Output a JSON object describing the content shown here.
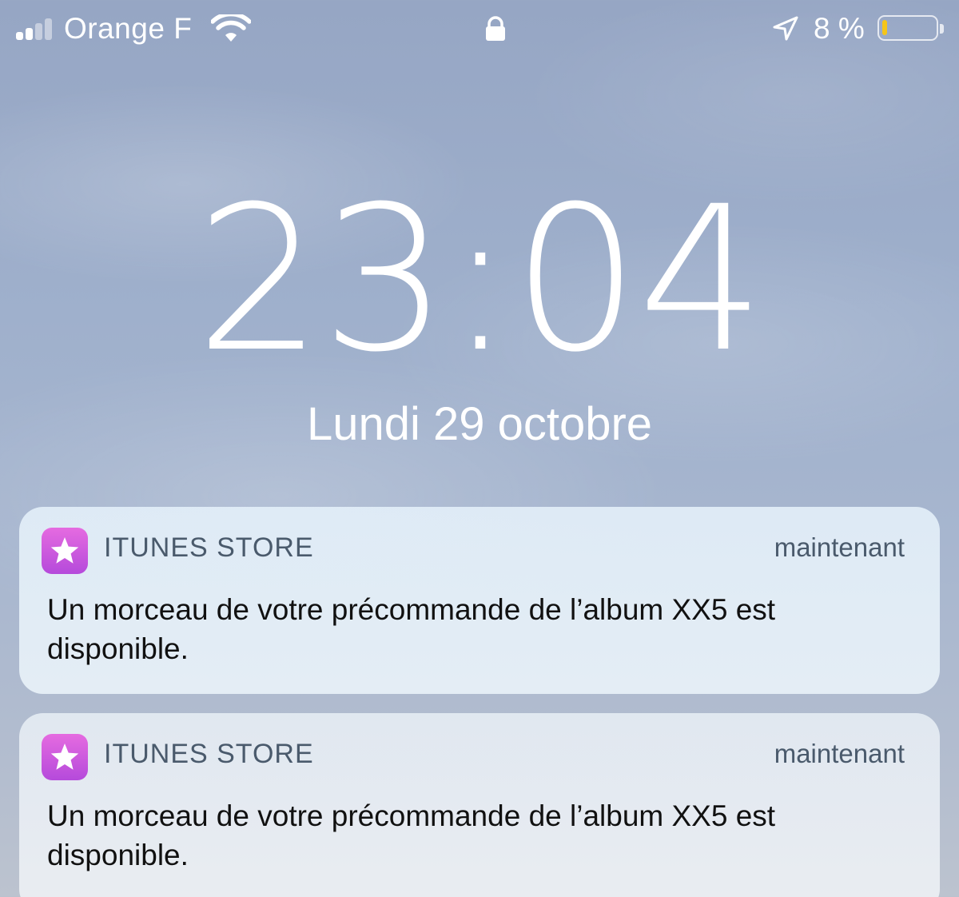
{
  "status_bar": {
    "carrier": "Orange F",
    "signal_bars_active": 2,
    "signal_bars_total": 4,
    "wifi_icon": "wifi-icon",
    "lock_icon": "lock-icon",
    "location_icon": "location-arrow-icon",
    "battery_percent_text": "8 %",
    "battery_level": 0.08,
    "battery_color": "#f5c518"
  },
  "lock_screen": {
    "time": "23:04",
    "date": "Lundi 29 octobre"
  },
  "notifications": [
    {
      "app_name": "ITUNES STORE",
      "app_icon": "star-icon",
      "timestamp": "maintenant",
      "message": "Un morceau de votre précommande de l’album XX5 est disponible."
    },
    {
      "app_name": "ITUNES STORE",
      "app_icon": "star-icon",
      "timestamp": "maintenant",
      "message": "Un morceau de votre précommande de l’album XX5 est disponible."
    }
  ],
  "colors": {
    "app_icon_gradient": [
      "#e56be0",
      "#b54adb"
    ],
    "notification_meta_text": "#4a5a6c",
    "notification_body_text": "#111111"
  }
}
